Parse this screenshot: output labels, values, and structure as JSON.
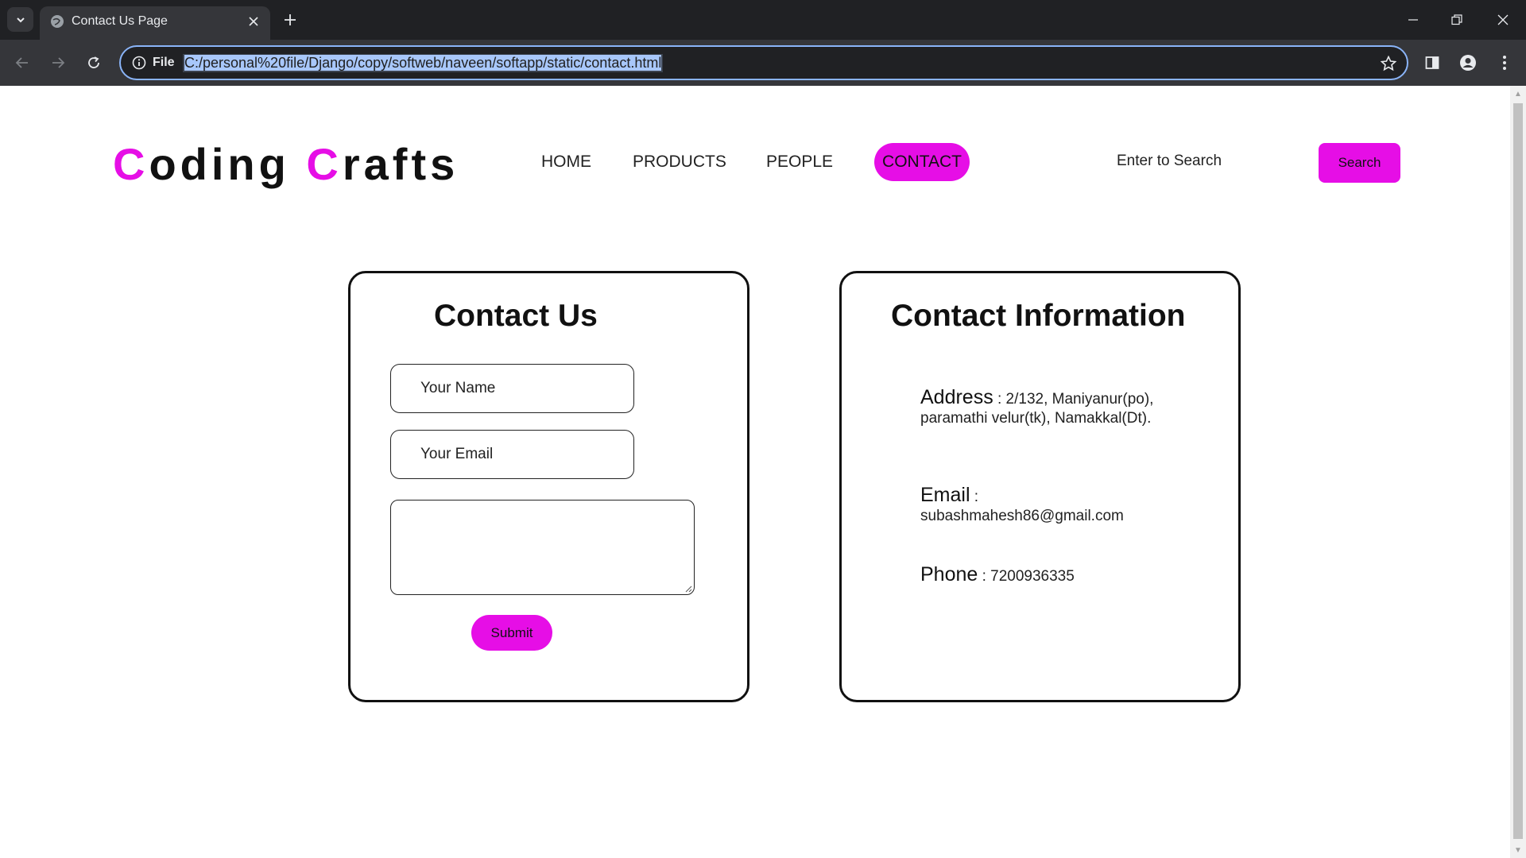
{
  "browser": {
    "tab_title": "Contact Us Page",
    "site_info_label": "File",
    "url": "C:/personal%20file/Django/copy/softweb/naveen/softapp/static/contact.html"
  },
  "header": {
    "logo_first_letter": "C",
    "logo_first_rest": "oding ",
    "logo_second_letter": "C",
    "logo_second_rest": "rafts",
    "nav": {
      "home": "HOME",
      "products": "PRODUCTS",
      "people": "PEOPLE",
      "contact": "CONTACT"
    },
    "search_text": "Enter to Search",
    "search_button": "Search"
  },
  "contact_form": {
    "title": "Contact Us",
    "name_placeholder": "Your Name",
    "email_placeholder": "Your Email",
    "message_value": "",
    "submit_label": "Submit"
  },
  "contact_info": {
    "title": "Contact Information",
    "address_label": "Address",
    "address_value": " : 2/132, Maniyanur(po), paramathi velur(tk), Namakkal(Dt).",
    "email_label": "Email",
    "email_separator": " :",
    "email_value": "subashmahesh86@gmail.com",
    "phone_label": "Phone",
    "phone_value": " : 7200936335"
  },
  "colors": {
    "accent": "#e60ee6",
    "text": "#111111",
    "chrome_dark": "#202124",
    "chrome_toolbar": "#35363a"
  },
  "icons": [
    "tab-search-icon",
    "globe-icon",
    "close-icon",
    "plus-icon",
    "minimize-icon",
    "restore-icon",
    "back-icon",
    "forward-icon",
    "reload-icon",
    "info-icon",
    "star-icon",
    "side-panel-icon",
    "profile-icon",
    "menu-icon"
  ]
}
